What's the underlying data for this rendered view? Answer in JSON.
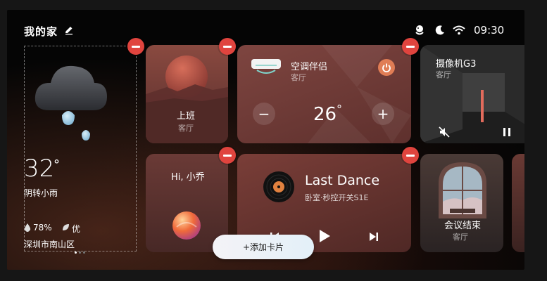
{
  "header": {
    "title": "我的家",
    "time": "09:30"
  },
  "weather": {
    "temperature": "32",
    "unit": "°",
    "condition": "阴转小雨",
    "humidity": "78%",
    "air_quality": "优",
    "location": "深圳市南山区"
  },
  "cards": {
    "commute": {
      "title": "上班",
      "room": "客厅"
    },
    "ac": {
      "title": "空调伴侣",
      "room": "客厅",
      "minus": "−",
      "temperature": "26",
      "unit": "°",
      "plus": "+"
    },
    "camera": {
      "title": "摄像机G3",
      "room": "客厅"
    },
    "assistant": {
      "greeting": "Hi, 小乔"
    },
    "music": {
      "song": "Last Dance",
      "device": "卧室·秒控开关S1E"
    },
    "meeting": {
      "title": "会议结束",
      "room": "客厅"
    }
  },
  "add_card_label": "+添加卡片",
  "colors": {
    "remove_badge": "#e0443e",
    "power": "#e07d55"
  }
}
